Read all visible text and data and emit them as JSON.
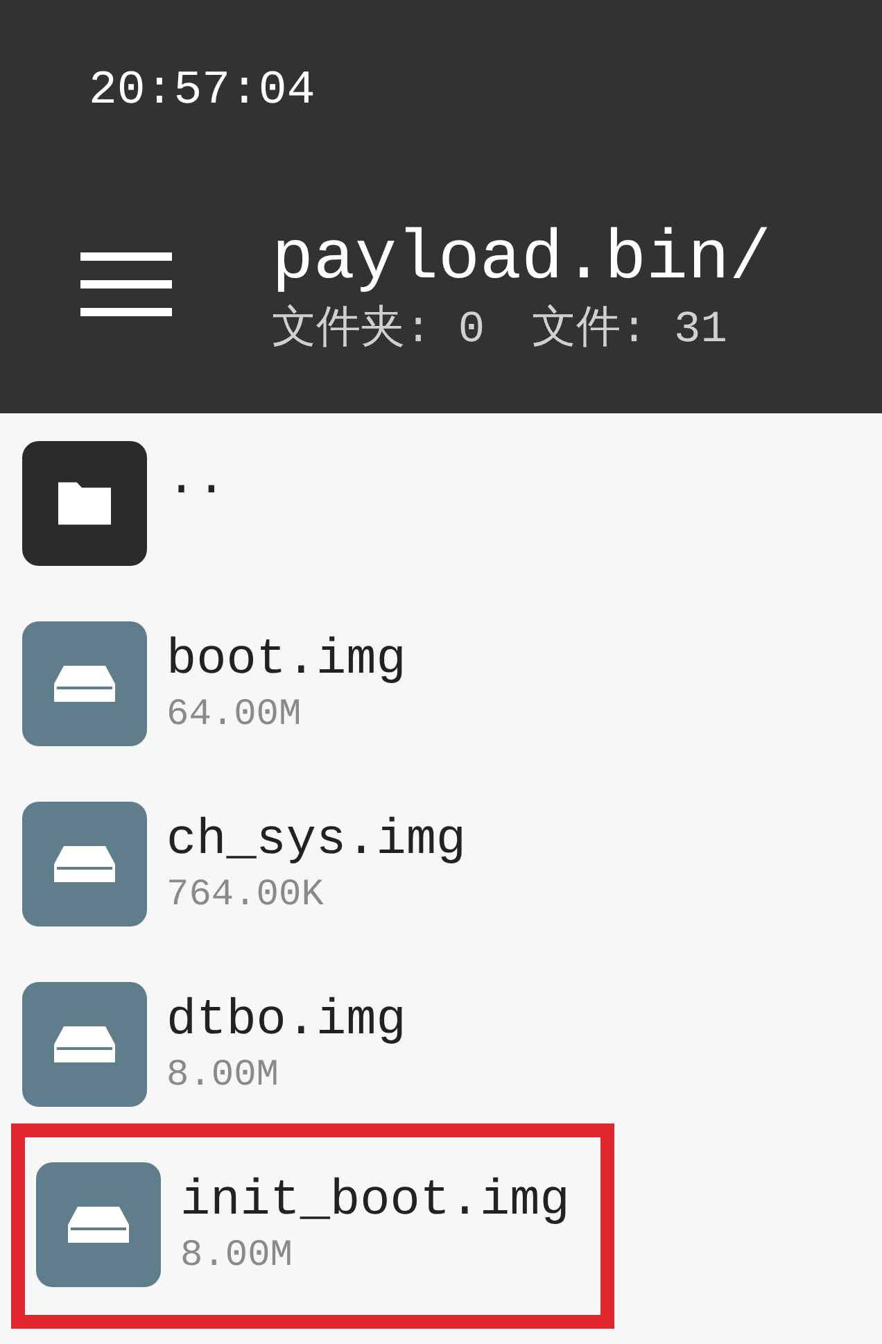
{
  "status_bar": {
    "time": "20:57:04"
  },
  "header": {
    "title": "payload.bin/",
    "folders_label": "文件夹: 0",
    "files_label": "文件: 31"
  },
  "items": [
    {
      "kind": "folder",
      "name": "..",
      "highlighted": false
    },
    {
      "kind": "file",
      "name": "boot.img",
      "size": "64.00M",
      "highlighted": false
    },
    {
      "kind": "file",
      "name": "ch_sys.img",
      "size": "764.00K",
      "highlighted": false
    },
    {
      "kind": "file",
      "name": "dtbo.img",
      "size": "8.00M",
      "highlighted": false
    },
    {
      "kind": "file",
      "name": "init_boot.img",
      "size": "8.00M",
      "highlighted": true
    }
  ]
}
